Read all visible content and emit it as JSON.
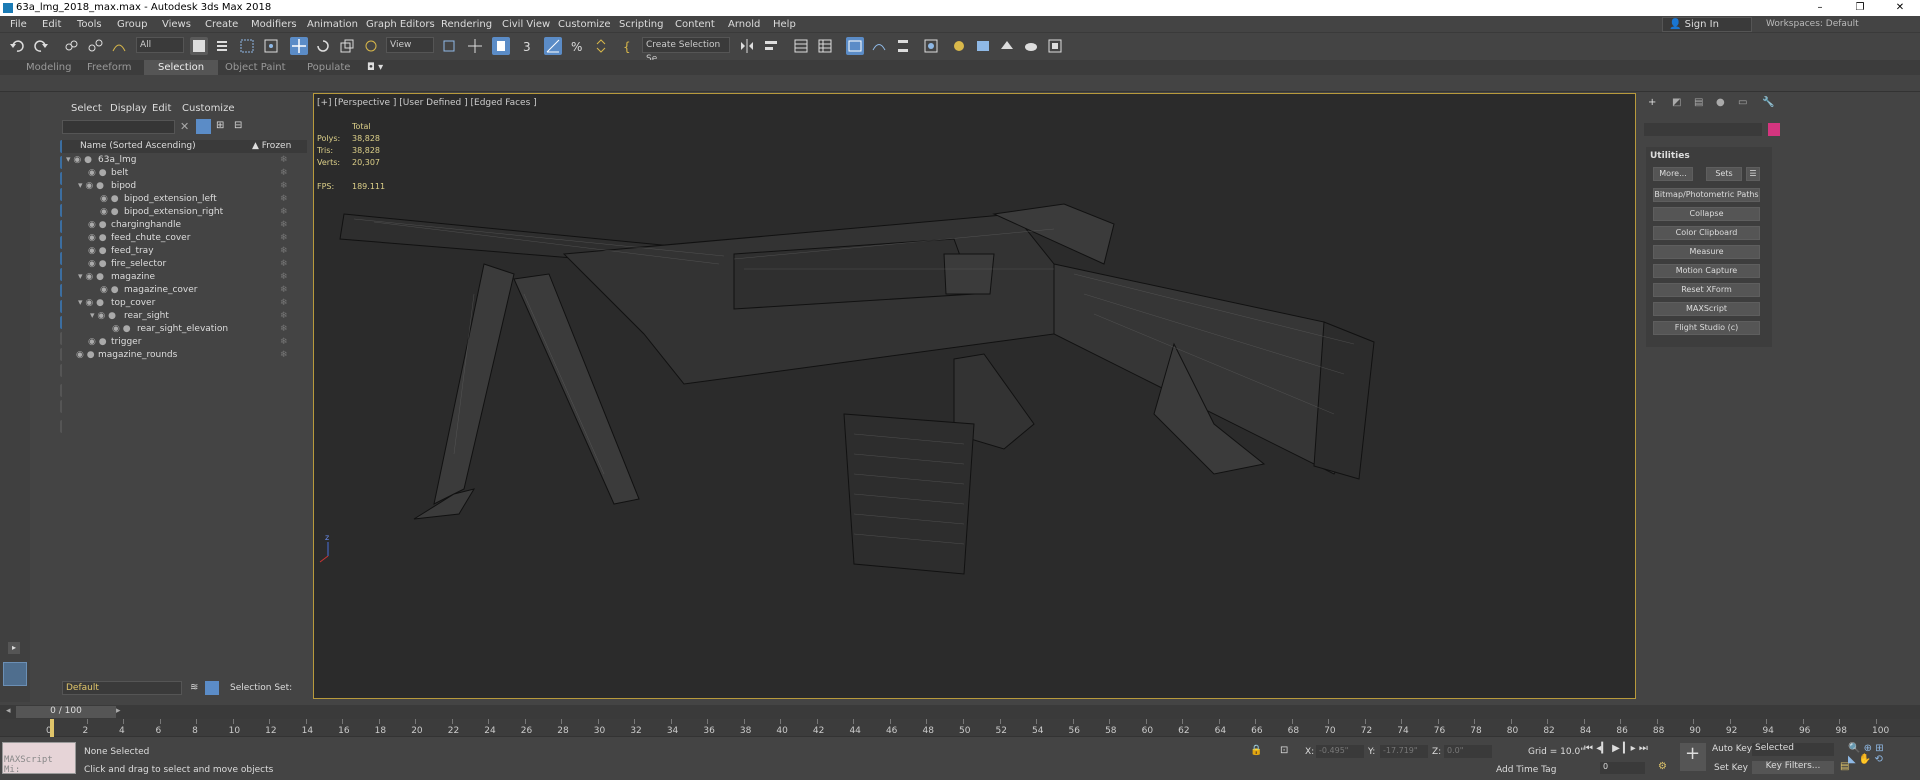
{
  "titlebar": {
    "title": "63a_lmg_2018_max.max - Autodesk 3ds Max 2018",
    "min": "–",
    "max": "❐",
    "close": "✕"
  },
  "menus": [
    "File",
    "Edit",
    "Tools",
    "Group",
    "Views",
    "Create",
    "Modifiers",
    "Animation",
    "Graph Editors",
    "Rendering",
    "Civil View",
    "Customize",
    "Scripting",
    "Content",
    "Arnold",
    "Help"
  ],
  "signin": "Sign In",
  "workspaces": "Workspaces: Default",
  "toolbar": {
    "filter": "All",
    "refcoord": "View",
    "selset": "Create Selection Se"
  },
  "ribbon": {
    "tabs": [
      "Modeling",
      "Freeform",
      "Selection",
      "Object Paint",
      "Populate"
    ],
    "active": "Selection"
  },
  "scene": {
    "menus": [
      "Select",
      "Display",
      "Edit",
      "Customize"
    ],
    "col_name": "Name (Sorted Ascending)",
    "col_frozen": "▲ Frozen",
    "items": [
      "63a_lmg",
      "belt",
      "bipod",
      "bipod_extension_left",
      "bipod_extension_right",
      "charginghandle",
      "feed_chute_cover",
      "feed_tray",
      "fire_selector",
      "magazine",
      "magazine_cover",
      "top_cover",
      "rear_sight",
      "rear_sight_elevation",
      "trigger",
      "magazine_rounds"
    ],
    "layer": "Default",
    "selset": "Selection Set:"
  },
  "viewport": {
    "label": "[+] [Perspective ] [User Defined ] [Edged Faces ]",
    "stats": {
      "total": "Total",
      "polys_l": "Polys:",
      "polys": "38,828",
      "tris_l": "Tris:",
      "tris": "38,828",
      "verts_l": "Verts:",
      "verts": "20,307",
      "fps_l": "FPS:",
      "fps": "189.111"
    }
  },
  "cmd": {
    "title": "Utilities",
    "more": "More...",
    "sets": "Sets",
    "buttons": [
      "Bitmap/Photometric Paths",
      "Collapse",
      "Color Clipboard",
      "Measure",
      "Motion Capture",
      "Reset XForm",
      "MAXScript",
      "Flight Studio (c)"
    ]
  },
  "time": {
    "frame": "0 / 100",
    "ticks": [
      "0",
      "2",
      "4",
      "6",
      "8",
      "10",
      "12",
      "14",
      "16",
      "18",
      "20",
      "22",
      "24",
      "26",
      "28",
      "30",
      "32",
      "34",
      "36",
      "38",
      "40",
      "42",
      "44",
      "46",
      "48",
      "50",
      "52",
      "54",
      "56",
      "58",
      "60",
      "62",
      "64",
      "66",
      "68",
      "70",
      "72",
      "74",
      "76",
      "78",
      "80",
      "82",
      "84",
      "86",
      "88",
      "90",
      "92",
      "94",
      "96",
      "98",
      "100"
    ]
  },
  "status": {
    "maxscript": "MAXScript Mi:",
    "selected": "None Selected",
    "prompt": "Click and drag to select and move objects",
    "x_l": "X:",
    "x": "-0.495\"",
    "y_l": "Y:",
    "y": "-17.719\"",
    "z_l": "Z:",
    "z": "0.0\"",
    "grid": "Grid = 10.0\"",
    "addtag": "Add Time Tag",
    "autokey": "Auto Key",
    "setkey": "Set Key",
    "selected_dd": "Selected",
    "keyfilters": "Key Filters...",
    "frame_in": "0"
  }
}
